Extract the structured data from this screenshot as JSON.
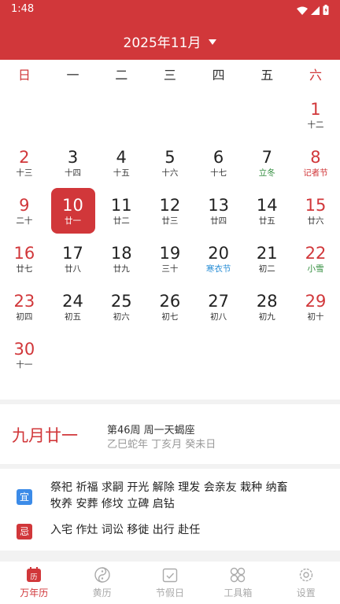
{
  "status": {
    "time": "1:48"
  },
  "header": {
    "month_title": "2025年11月"
  },
  "weekdays": [
    "日",
    "一",
    "二",
    "三",
    "四",
    "五",
    "六"
  ],
  "days": [
    {
      "n": "1",
      "s": "十二"
    },
    {
      "n": "2",
      "s": "十三"
    },
    {
      "n": "3",
      "s": "十四"
    },
    {
      "n": "4",
      "s": "十五"
    },
    {
      "n": "5",
      "s": "十六"
    },
    {
      "n": "6",
      "s": "十七"
    },
    {
      "n": "7",
      "s": "立冬"
    },
    {
      "n": "8",
      "s": "记者节"
    },
    {
      "n": "9",
      "s": "二十"
    },
    {
      "n": "10",
      "s": "廿一"
    },
    {
      "n": "11",
      "s": "廿二"
    },
    {
      "n": "12",
      "s": "廿三"
    },
    {
      "n": "13",
      "s": "廿四"
    },
    {
      "n": "14",
      "s": "廿五"
    },
    {
      "n": "15",
      "s": "廿六"
    },
    {
      "n": "16",
      "s": "廿七"
    },
    {
      "n": "17",
      "s": "廿八"
    },
    {
      "n": "18",
      "s": "廿九"
    },
    {
      "n": "19",
      "s": "三十"
    },
    {
      "n": "20",
      "s": "寒衣节"
    },
    {
      "n": "21",
      "s": "初二"
    },
    {
      "n": "22",
      "s": "小雪"
    },
    {
      "n": "23",
      "s": "初四"
    },
    {
      "n": "24",
      "s": "初五"
    },
    {
      "n": "25",
      "s": "初六"
    },
    {
      "n": "26",
      "s": "初七"
    },
    {
      "n": "27",
      "s": "初八"
    },
    {
      "n": "28",
      "s": "初九"
    },
    {
      "n": "29",
      "s": "初十"
    },
    {
      "n": "30",
      "s": "十一"
    }
  ],
  "info": {
    "lunar_date": "九月廿一",
    "line1": "第46周  周一天蝎座",
    "line2": "乙巳蛇年  丁亥月  癸未日"
  },
  "almanac": {
    "yi_label": "宜",
    "yi_text": "祭祀 祈福 求嗣 开光 解除 理发 会亲友 栽种 纳畜 牧养 安葬 修坟 立碑 启钻",
    "ji_label": "忌",
    "ji_text": "入宅 作灶 词讼 移徙 出行 赴任"
  },
  "nav": {
    "tabs": [
      "万年历",
      "黄历",
      "节假日",
      "工具箱",
      "设置"
    ],
    "active_icon_glyph": "历"
  },
  "colors": {
    "accent": "#d1373a",
    "yi": "#3b8be8",
    "solar_term": "#2e8b3a",
    "festival_blue": "#2b8fd6"
  }
}
